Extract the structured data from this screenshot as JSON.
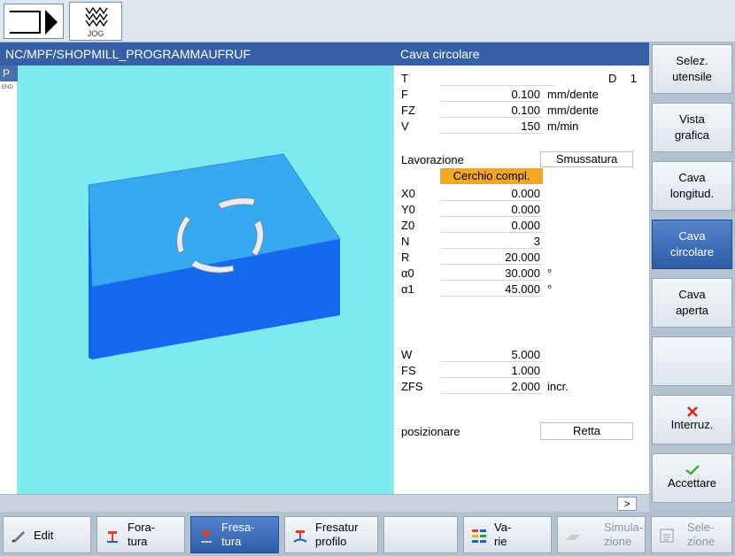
{
  "topbar": {
    "mode_label": "JOG"
  },
  "header": {
    "path": "NC/MPF/SHOPMILL_PROGRAMMAUFRUF",
    "cycle": "Cava circolare"
  },
  "left_strip": {
    "p_label": "P",
    "end_label": "END"
  },
  "params": {
    "T": {
      "label": "T",
      "value": ""
    },
    "D": {
      "label": "D",
      "value": "1"
    },
    "F": {
      "label": "F",
      "value": "0.100",
      "unit": "mm/dente"
    },
    "FZ": {
      "label": "FZ",
      "value": "0.100",
      "unit": "mm/dente"
    },
    "V": {
      "label": "V",
      "value": "150",
      "unit": "m/min"
    },
    "lavorazione": {
      "label": "Lavorazione",
      "value": "Smussatura"
    },
    "cerchio": "Cerchio compl.",
    "X0": {
      "label": "X0",
      "value": "0.000"
    },
    "Y0": {
      "label": "Y0",
      "value": "0.000"
    },
    "Z0": {
      "label": "Z0",
      "value": "0.000"
    },
    "N": {
      "label": "N",
      "value": "3"
    },
    "R": {
      "label": "R",
      "value": "20.000"
    },
    "a0": {
      "label": "α0",
      "value": "30.000",
      "unit": "°"
    },
    "a1": {
      "label": "α1",
      "value": "45.000",
      "unit": "°"
    },
    "W": {
      "label": "W",
      "value": "5.000"
    },
    "FS": {
      "label": "FS",
      "value": "1.000"
    },
    "ZFS": {
      "label": "ZFS",
      "value": "2.000",
      "unit": "incr."
    },
    "posizionare": {
      "label": "posizionare",
      "value": "Retta"
    }
  },
  "bottom_strip": {
    "more": ">"
  },
  "right_softkeys": [
    {
      "line1": "Selez.",
      "line2": "utensile"
    },
    {
      "line1": "Vista",
      "line2": "grafica"
    },
    {
      "line1": "Cava",
      "line2": "longitud."
    },
    {
      "line1": "Cava",
      "line2": "circolare"
    },
    {
      "line1": "Cava",
      "line2": "aperta"
    },
    {
      "line1": "",
      "line2": ""
    },
    {
      "line1": "Interruz.",
      "line2": ""
    },
    {
      "line1": "Accettare",
      "line2": ""
    }
  ],
  "bottom_softkeys": [
    {
      "line1": "Edit",
      "line2": ""
    },
    {
      "line1": "Fora-",
      "line2": "tura"
    },
    {
      "line1": "Fresa-",
      "line2": "tura"
    },
    {
      "line1": "Fresatur",
      "line2": "profilo"
    },
    {
      "line1": "",
      "line2": ""
    },
    {
      "line1": "Va-",
      "line2": "rie"
    },
    {
      "line1": "Simula-",
      "line2": "zione"
    },
    {
      "line1": "Sele-",
      "line2": "zione"
    }
  ],
  "colors": {
    "header_blue": "#3560a8",
    "graphic_bg": "#7eeaf0",
    "block_top": "#37a9f2",
    "block_front": "#1569f0",
    "block_side": "#0b4fd8",
    "highlight_orange": "#f5a623",
    "active_softkey": "#2f5ea8"
  }
}
